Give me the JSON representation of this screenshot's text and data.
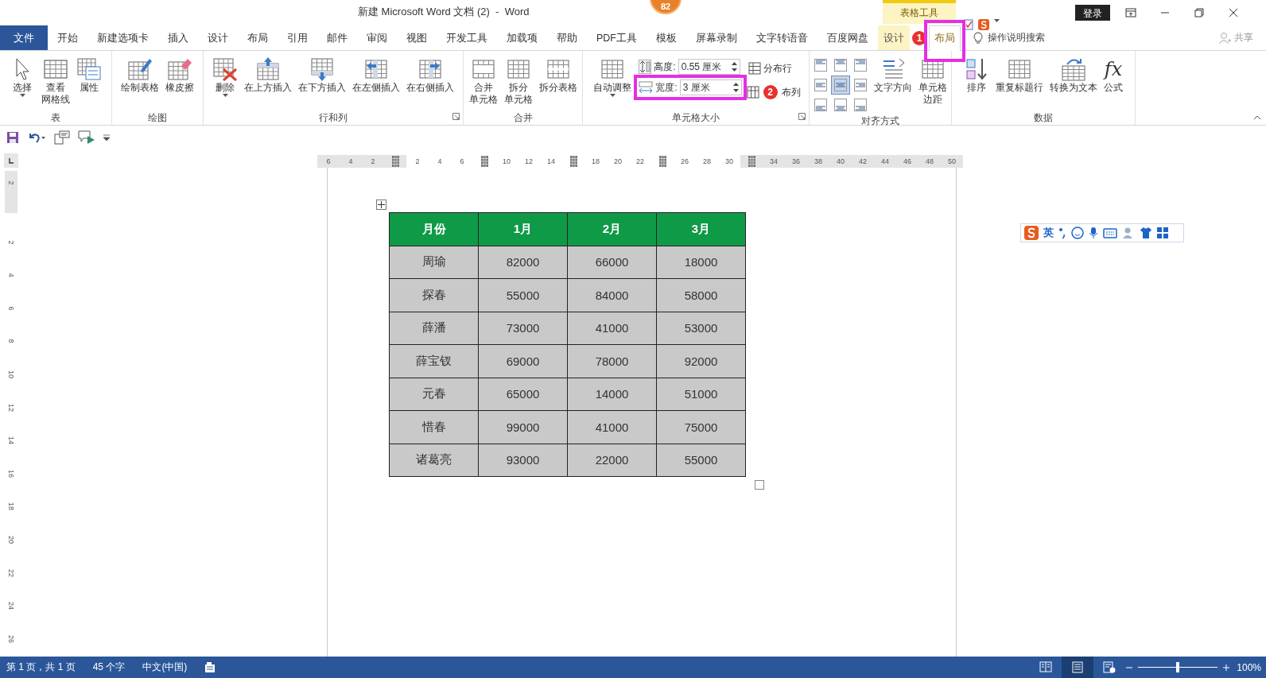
{
  "window": {
    "title": "新建 Microsoft Word 文档 (2)  -  Word",
    "badge": "82",
    "context_header": "表格工具",
    "account": "登录"
  },
  "tabs": [
    {
      "label": "文件",
      "kind": "file",
      "selected": false
    },
    {
      "label": "开始",
      "kind": "normal",
      "selected": false
    },
    {
      "label": "新建选项卡",
      "kind": "normal",
      "selected": false
    },
    {
      "label": "插入",
      "kind": "normal",
      "selected": false
    },
    {
      "label": "设计",
      "kind": "normal",
      "selected": false
    },
    {
      "label": "布局",
      "kind": "normal",
      "selected": false
    },
    {
      "label": "引用",
      "kind": "normal",
      "selected": false
    },
    {
      "label": "邮件",
      "kind": "normal",
      "selected": false
    },
    {
      "label": "审阅",
      "kind": "normal",
      "selected": false
    },
    {
      "label": "视图",
      "kind": "normal",
      "selected": false
    },
    {
      "label": "开发工具",
      "kind": "normal",
      "selected": false
    },
    {
      "label": "加载项",
      "kind": "normal",
      "selected": false
    },
    {
      "label": "帮助",
      "kind": "normal",
      "selected": false
    },
    {
      "label": "PDF工具",
      "kind": "normal",
      "selected": false
    },
    {
      "label": "模板",
      "kind": "normal",
      "selected": false
    },
    {
      "label": "屏幕录制",
      "kind": "normal",
      "selected": false
    },
    {
      "label": "文字转语音",
      "kind": "normal",
      "selected": false
    },
    {
      "label": "百度网盘",
      "kind": "normal",
      "selected": false
    },
    {
      "label": "设计",
      "kind": "context",
      "selected": false
    },
    {
      "label": "布局",
      "kind": "context",
      "selected": true
    }
  ],
  "tell_me": "操作说明搜索",
  "share": "共享",
  "ribbon": [
    {
      "label": "表",
      "launcher": false,
      "items": [
        {
          "kind": "select",
          "label": "选择",
          "dropdown": true
        },
        {
          "kind": "gridlines",
          "lines": [
            "查看",
            "网格线"
          ],
          "dropdown": false
        },
        {
          "kind": "props",
          "label": "属性",
          "dropdown": false
        }
      ]
    },
    {
      "label": "绘图",
      "launcher": false,
      "items": [
        {
          "kind": "draw",
          "label": "绘制表格",
          "dropdown": false
        },
        {
          "kind": "erase",
          "label": "橡皮擦",
          "dropdown": false
        }
      ]
    },
    {
      "label": "行和列",
      "launcher": true,
      "items": [
        {
          "kind": "delete",
          "label": "删除",
          "dropdown": true
        },
        {
          "kind": "ins-above",
          "label": "在上方插入",
          "dropdown": false
        },
        {
          "kind": "ins-below",
          "label": "在下方插入",
          "dropdown": false
        },
        {
          "kind": "ins-left",
          "label": "在左侧插入",
          "dropdown": false
        },
        {
          "kind": "ins-right",
          "label": "在右侧插入",
          "dropdown": false
        }
      ]
    },
    {
      "label": "合并",
      "launcher": false,
      "items": [
        {
          "kind": "merge",
          "lines": [
            "合并",
            "单元格"
          ],
          "dropdown": false
        },
        {
          "kind": "split",
          "lines": [
            "拆分",
            "单元格"
          ],
          "dropdown": false
        },
        {
          "kind": "split-table",
          "label": "拆分表格",
          "dropdown": false
        }
      ]
    },
    {
      "label": "单元格大小",
      "launcher": true,
      "items": [
        {
          "kind": "autofit",
          "label": "自动调整",
          "dropdown": true
        },
        {
          "kind": "stack",
          "items": [
            {
              "kind": "height",
              "label": "高度:",
              "value": "0.55 厘米"
            },
            {
              "kind": "width",
              "label": "宽度:",
              "value": "3 厘米"
            }
          ]
        },
        {
          "kind": "stack",
          "items": [
            {
              "kind": "dist-rows",
              "label": "分布行"
            },
            {
              "kind": "dist-cols",
              "label": "布列"
            }
          ]
        }
      ]
    },
    {
      "label": "对齐方式",
      "launcher": false,
      "items": [
        {
          "kind": "align-grid",
          "items": [
            {
              "selected": false
            },
            {
              "selected": false
            },
            {
              "selected": false
            },
            {
              "selected": false
            },
            {
              "selected": true
            },
            {
              "selected": false
            },
            {
              "selected": false
            },
            {
              "selected": false
            },
            {
              "selected": false
            }
          ]
        },
        {
          "kind": "text-dir",
          "label": "文字方向",
          "dropdown": false
        },
        {
          "kind": "margins",
          "lines": [
            "单元格",
            "边距"
          ],
          "dropdown": false
        }
      ]
    },
    {
      "label": "数据",
      "launcher": false,
      "items": [
        {
          "kind": "sort",
          "label": "排序",
          "dropdown": false
        },
        {
          "kind": "repeat",
          "label": "重复标题行",
          "dropdown": false
        },
        {
          "kind": "convert",
          "label": "转换为文本",
          "dropdown": false
        },
        {
          "kind": "formula",
          "label": "公式",
          "glyph": "fx",
          "dropdown": false
        }
      ]
    }
  ],
  "ruler": {
    "horizontal": [
      {
        "kind": "num",
        "text": "6",
        "shaded": true
      },
      {
        "kind": "num",
        "text": "4",
        "shaded": true
      },
      {
        "kind": "num",
        "text": "2",
        "shaded": true
      },
      {
        "kind": "marker",
        "shaded": true
      },
      {
        "kind": "num",
        "text": "2",
        "shaded": false
      },
      {
        "kind": "num",
        "text": "4",
        "shaded": false
      },
      {
        "kind": "num",
        "text": "6",
        "shaded": false
      },
      {
        "kind": "marker",
        "shaded": false
      },
      {
        "kind": "num",
        "text": "10",
        "shaded": false
      },
      {
        "kind": "num",
        "text": "12",
        "shaded": false
      },
      {
        "kind": "num",
        "text": "14",
        "shaded": false
      },
      {
        "kind": "marker",
        "shaded": false
      },
      {
        "kind": "num",
        "text": "18",
        "shaded": false
      },
      {
        "kind": "num",
        "text": "20",
        "shaded": false
      },
      {
        "kind": "num",
        "text": "22",
        "shaded": false
      },
      {
        "kind": "marker",
        "shaded": false
      },
      {
        "kind": "num",
        "text": "26",
        "shaded": false
      },
      {
        "kind": "num",
        "text": "28",
        "shaded": false
      },
      {
        "kind": "num",
        "text": "30",
        "shaded": false
      },
      {
        "kind": "marker",
        "shaded": true
      },
      {
        "kind": "num",
        "text": "34",
        "shaded": true
      },
      {
        "kind": "num",
        "text": "36",
        "shaded": true
      },
      {
        "kind": "num",
        "text": "38",
        "shaded": true
      },
      {
        "kind": "num",
        "text": "40",
        "shaded": true
      },
      {
        "kind": "num",
        "text": "42",
        "shaded": true
      },
      {
        "kind": "num",
        "text": "44",
        "shaded": true
      },
      {
        "kind": "num",
        "text": "46",
        "shaded": true
      },
      {
        "kind": "num",
        "text": "48",
        "shaded": true
      },
      {
        "kind": "num",
        "text": "50",
        "shaded": true
      }
    ],
    "vertical": [
      {
        "text": "2",
        "shaded": true
      },
      {
        "text": "2",
        "shaded": false
      },
      {
        "text": "4",
        "shaded": false
      },
      {
        "text": "6",
        "shaded": false
      },
      {
        "text": "8",
        "shaded": false
      },
      {
        "text": "10",
        "shaded": false
      },
      {
        "text": "12",
        "shaded": false
      },
      {
        "text": "14",
        "shaded": false
      },
      {
        "text": "16",
        "shaded": false
      },
      {
        "text": "18",
        "shaded": false
      },
      {
        "text": "20",
        "shaded": false
      },
      {
        "text": "22",
        "shaded": false
      },
      {
        "text": "24",
        "shaded": false
      },
      {
        "text": "26",
        "shaded": false
      }
    ]
  },
  "table": {
    "columns": [
      "月份",
      "1月",
      "2月",
      "3月"
    ],
    "rows": [
      [
        "周瑜",
        "82000",
        "66000",
        "18000"
      ],
      [
        "探春",
        "55000",
        "84000",
        "58000"
      ],
      [
        "薛潘",
        "73000",
        "41000",
        "53000"
      ],
      [
        "薛宝钗",
        "69000",
        "78000",
        "92000"
      ],
      [
        "元春",
        "65000",
        "14000",
        "51000"
      ],
      [
        "惜春",
        "99000",
        "41000",
        "75000"
      ],
      [
        "诸葛亮",
        "93000",
        "22000",
        "55000"
      ]
    ]
  },
  "ime_toolbar": {
    "mode": "英"
  },
  "annotations": [
    {
      "number": "1"
    },
    {
      "number": "2"
    }
  ],
  "status_bar": {
    "page": "第 1 页，共 1 页",
    "words": "45 个字",
    "language": "中文(中国)",
    "views": [
      {
        "selected": false
      },
      {
        "selected": true
      },
      {
        "selected": false
      }
    ],
    "zoom": {
      "level": 0.5,
      "reading": "100%"
    }
  }
}
